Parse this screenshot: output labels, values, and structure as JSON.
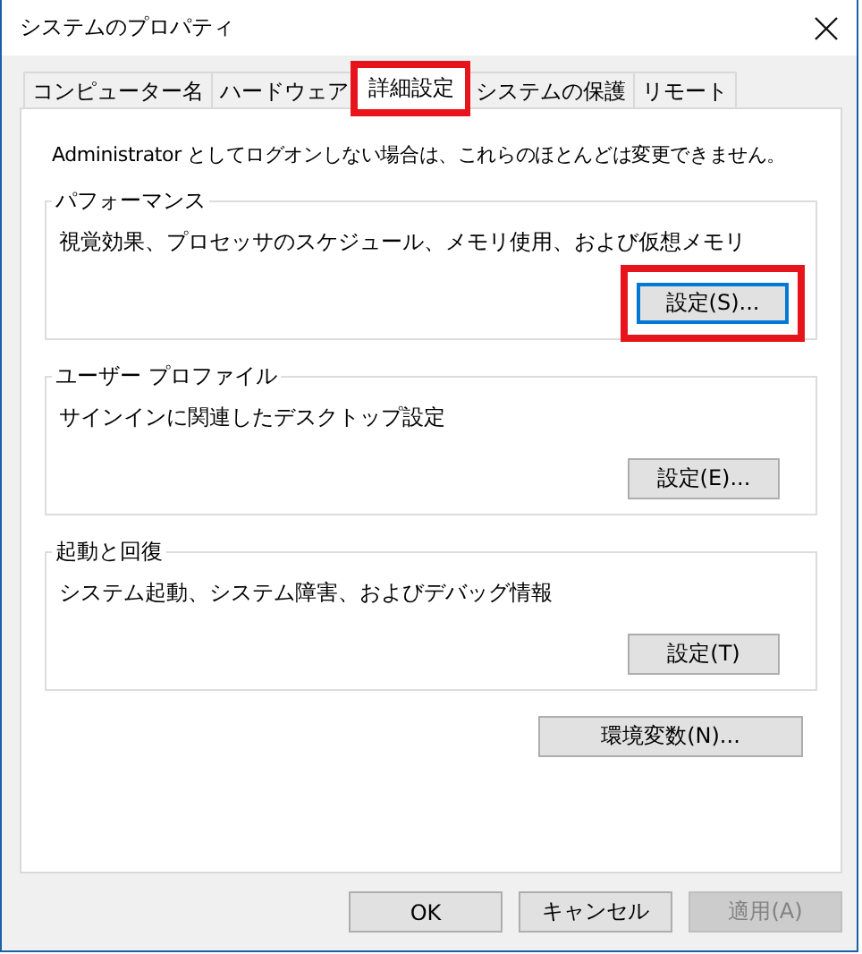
{
  "window": {
    "title": "システムのプロパティ"
  },
  "tabs": [
    {
      "label": "コンピューター名",
      "selected": false,
      "highlighted": false
    },
    {
      "label": "ハードウェア",
      "selected": false,
      "highlighted": false
    },
    {
      "label": "詳細設定",
      "selected": true,
      "highlighted": true
    },
    {
      "label": "システムの保護",
      "selected": false,
      "highlighted": false
    },
    {
      "label": "リモート",
      "selected": false,
      "highlighted": false
    }
  ],
  "notice": "Administrator としてログオンしない場合は、これらのほとんどは変更できません。",
  "groups": [
    {
      "title": "パフォーマンス",
      "description": "視覚効果、プロセッサのスケジュール、メモリ使用、および仮想メモリ",
      "button": {
        "label": "設定(S)...",
        "focused": true,
        "highlighted": true
      }
    },
    {
      "title": "ユーザー プロファイル",
      "description": "サインインに関連したデスクトップ設定",
      "button": {
        "label": "設定(E)...",
        "focused": false,
        "highlighted": false
      }
    },
    {
      "title": "起動と回復",
      "description": "システム起動、システム障害、およびデバッグ情報",
      "button": {
        "label": "設定(T)",
        "focused": false,
        "highlighted": false
      }
    }
  ],
  "env_button": {
    "label": "環境変数(N)..."
  },
  "buttons": [
    {
      "label": "OK",
      "disabled": false
    },
    {
      "label": "キャンセル",
      "disabled": false
    },
    {
      "label": "適用(A)",
      "disabled": true
    }
  ]
}
